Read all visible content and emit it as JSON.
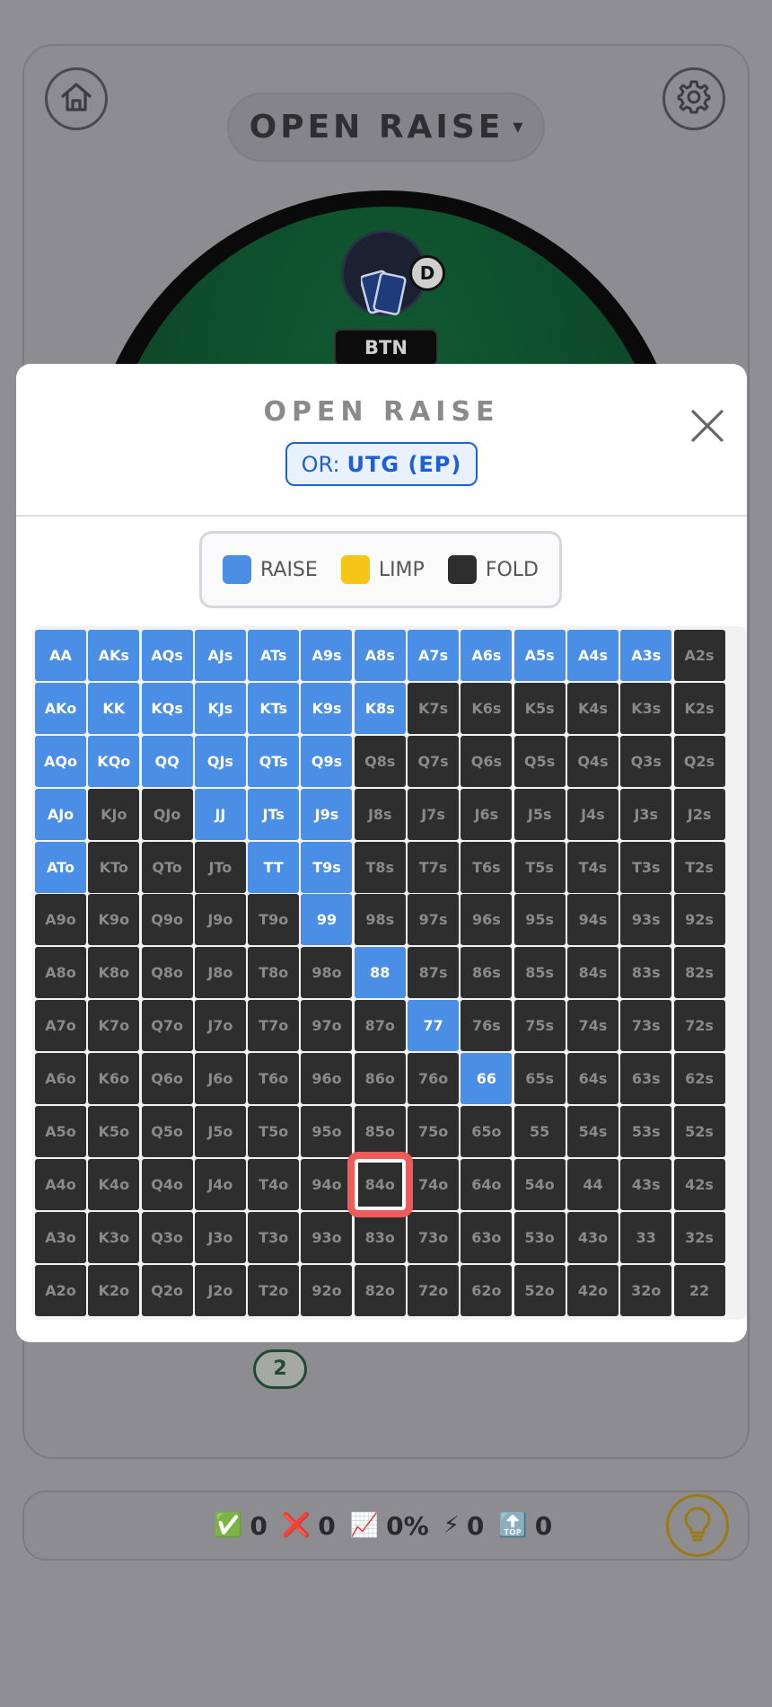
{
  "header": {
    "mode_label": "OPEN RAISE",
    "mode_caret": "▾"
  },
  "table": {
    "hero_position": "BTN",
    "dealer_chip": "D",
    "pot_badge": "2"
  },
  "stats": {
    "correct": "0",
    "wrong": "0",
    "accuracy": "0%",
    "streak": "0",
    "best": "0",
    "icons": {
      "correct": "✅",
      "wrong": "❌",
      "accuracy": "📈",
      "streak": "⚡",
      "best": "🔝"
    }
  },
  "modal": {
    "title": "OPEN RAISE",
    "position_prefix": "OR:",
    "position_value": "UTG (EP)",
    "legend": [
      {
        "label": "RAISE",
        "color": "#4a8ee6"
      },
      {
        "label": "LIMP",
        "color": "#f5c518"
      },
      {
        "label": "FOLD",
        "color": "#2e2e2e"
      }
    ],
    "selected_hand": "84o",
    "grid": [
      [
        "AA",
        "AKs",
        "AQs",
        "AJs",
        "ATs",
        "A9s",
        "A8s",
        "A7s",
        "A6s",
        "A5s",
        "A4s",
        "A3s",
        "A2s"
      ],
      [
        "AKo",
        "KK",
        "KQs",
        "KJs",
        "KTs",
        "K9s",
        "K8s",
        "K7s",
        "K6s",
        "K5s",
        "K4s",
        "K3s",
        "K2s"
      ],
      [
        "AQo",
        "KQo",
        "QQ",
        "QJs",
        "QTs",
        "Q9s",
        "Q8s",
        "Q7s",
        "Q6s",
        "Q5s",
        "Q4s",
        "Q3s",
        "Q2s"
      ],
      [
        "AJo",
        "KJo",
        "QJo",
        "JJ",
        "JTs",
        "J9s",
        "J8s",
        "J7s",
        "J6s",
        "J5s",
        "J4s",
        "J3s",
        "J2s"
      ],
      [
        "ATo",
        "KTo",
        "QTo",
        "JTo",
        "TT",
        "T9s",
        "T8s",
        "T7s",
        "T6s",
        "T5s",
        "T4s",
        "T3s",
        "T2s"
      ],
      [
        "A9o",
        "K9o",
        "Q9o",
        "J9o",
        "T9o",
        "99",
        "98s",
        "97s",
        "96s",
        "95s",
        "94s",
        "93s",
        "92s"
      ],
      [
        "A8o",
        "K8o",
        "Q8o",
        "J8o",
        "T8o",
        "98o",
        "88",
        "87s",
        "86s",
        "85s",
        "84s",
        "83s",
        "82s"
      ],
      [
        "A7o",
        "K7o",
        "Q7o",
        "J7o",
        "T7o",
        "97o",
        "87o",
        "77",
        "76s",
        "75s",
        "74s",
        "73s",
        "72s"
      ],
      [
        "A6o",
        "K6o",
        "Q6o",
        "J6o",
        "T6o",
        "96o",
        "86o",
        "76o",
        "66",
        "65s",
        "64s",
        "63s",
        "62s"
      ],
      [
        "A5o",
        "K5o",
        "Q5o",
        "J5o",
        "T5o",
        "95o",
        "85o",
        "75o",
        "65o",
        "55",
        "54s",
        "53s",
        "52s"
      ],
      [
        "A4o",
        "K4o",
        "Q4o",
        "J4o",
        "T4o",
        "94o",
        "84o",
        "74o",
        "64o",
        "54o",
        "44",
        "43s",
        "42s"
      ],
      [
        "A3o",
        "K3o",
        "Q3o",
        "J3o",
        "T3o",
        "93o",
        "83o",
        "73o",
        "63o",
        "53o",
        "43o",
        "33",
        "32s"
      ],
      [
        "A2o",
        "K2o",
        "Q2o",
        "J2o",
        "T2o",
        "92o",
        "82o",
        "72o",
        "62o",
        "52o",
        "42o",
        "32o",
        "22"
      ]
    ],
    "actions": [
      [
        "raise",
        "raise",
        "raise",
        "raise",
        "raise",
        "raise",
        "raise",
        "raise",
        "raise",
        "raise",
        "raise",
        "raise",
        "fold"
      ],
      [
        "raise",
        "raise",
        "raise",
        "raise",
        "raise",
        "raise",
        "raise",
        "fold",
        "fold",
        "fold",
        "fold",
        "fold",
        "fold"
      ],
      [
        "raise",
        "raise",
        "raise",
        "raise",
        "raise",
        "raise",
        "fold",
        "fold",
        "fold",
        "fold",
        "fold",
        "fold",
        "fold"
      ],
      [
        "raise",
        "fold",
        "fold",
        "raise",
        "raise",
        "raise",
        "fold",
        "fold",
        "fold",
        "fold",
        "fold",
        "fold",
        "fold"
      ],
      [
        "raise",
        "fold",
        "fold",
        "fold",
        "raise",
        "raise",
        "fold",
        "fold",
        "fold",
        "fold",
        "fold",
        "fold",
        "fold"
      ],
      [
        "fold",
        "fold",
        "fold",
        "fold",
        "fold",
        "raise",
        "fold",
        "fold",
        "fold",
        "fold",
        "fold",
        "fold",
        "fold"
      ],
      [
        "fold",
        "fold",
        "fold",
        "fold",
        "fold",
        "fold",
        "raise",
        "fold",
        "fold",
        "fold",
        "fold",
        "fold",
        "fold"
      ],
      [
        "fold",
        "fold",
        "fold",
        "fold",
        "fold",
        "fold",
        "fold",
        "raise",
        "fold",
        "fold",
        "fold",
        "fold",
        "fold"
      ],
      [
        "fold",
        "fold",
        "fold",
        "fold",
        "fold",
        "fold",
        "fold",
        "fold",
        "raise",
        "fold",
        "fold",
        "fold",
        "fold"
      ],
      [
        "fold",
        "fold",
        "fold",
        "fold",
        "fold",
        "fold",
        "fold",
        "fold",
        "fold",
        "fold",
        "fold",
        "fold",
        "fold"
      ],
      [
        "fold",
        "fold",
        "fold",
        "fold",
        "fold",
        "fold",
        "fold",
        "fold",
        "fold",
        "fold",
        "fold",
        "fold",
        "fold"
      ],
      [
        "fold",
        "fold",
        "fold",
        "fold",
        "fold",
        "fold",
        "fold",
        "fold",
        "fold",
        "fold",
        "fold",
        "fold",
        "fold"
      ],
      [
        "fold",
        "fold",
        "fold",
        "fold",
        "fold",
        "fold",
        "fold",
        "fold",
        "fold",
        "fold",
        "fold",
        "fold",
        "fold"
      ]
    ]
  }
}
